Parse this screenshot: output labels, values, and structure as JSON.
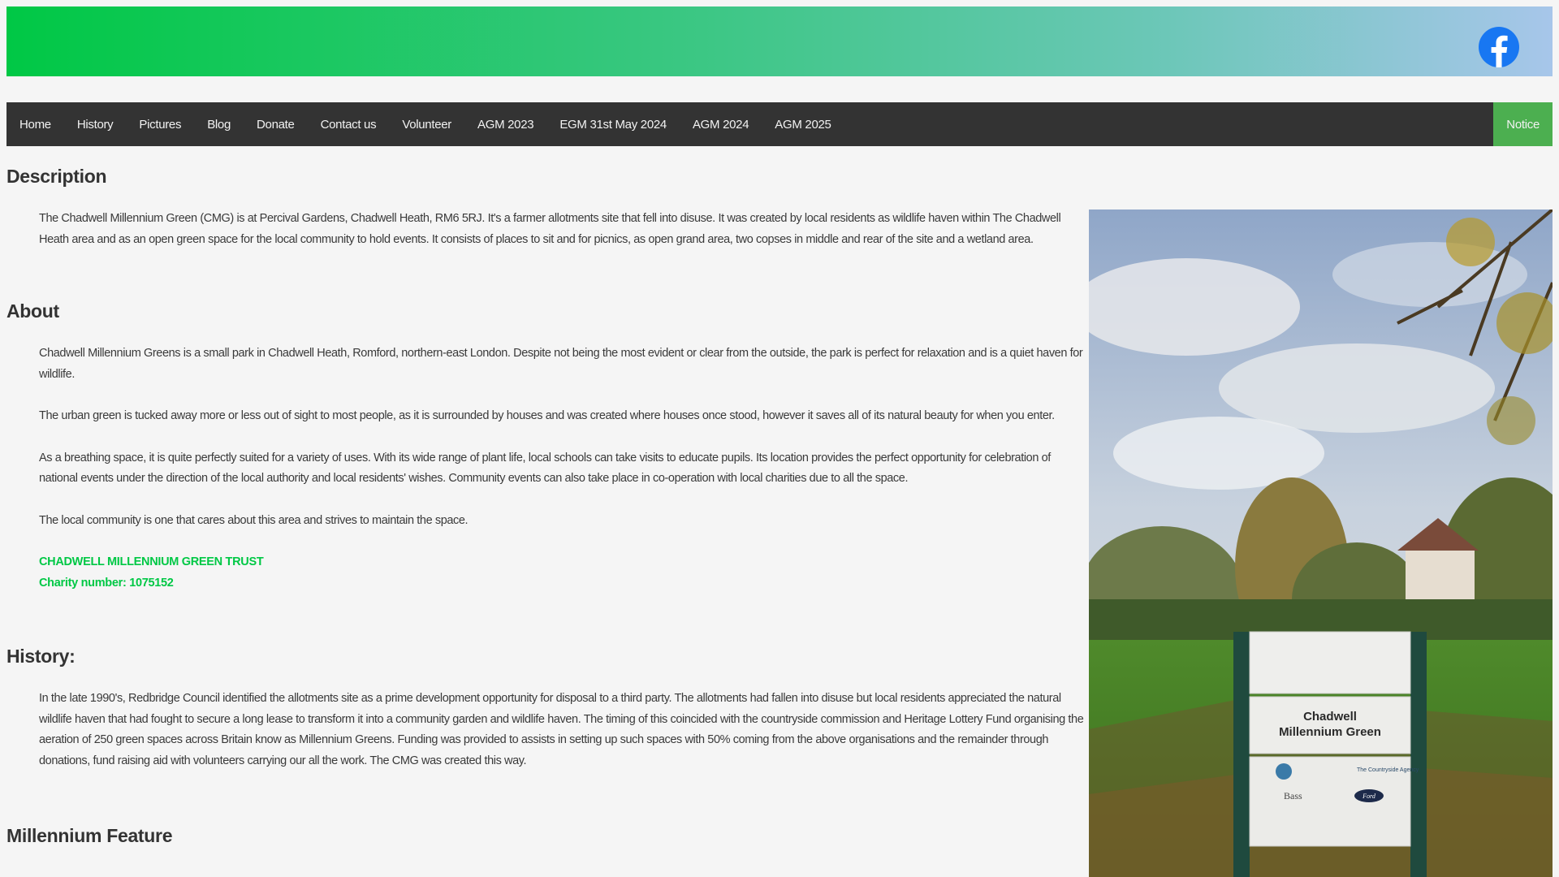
{
  "nav": {
    "items": [
      "Home",
      "History",
      "Pictures",
      "Blog",
      "Donate",
      "Contact us",
      "Volunteer",
      "AGM 2023",
      "EGM 31st May 2024",
      "AGM 2024",
      "AGM 2025"
    ],
    "notice": "Notice"
  },
  "icons": {
    "social": "facebook-icon"
  },
  "colors": {
    "accent_green": "#00c845",
    "nav_background": "#333333",
    "notice_background": "#4caf50",
    "facebook_blue": "#1877f2"
  },
  "sections": {
    "description": {
      "title": "Description",
      "text": "The Chadwell Millennium Green (CMG) is at Percival Gardens, Chadwell Heath, RM6 5RJ. It's a farmer allotments site that fell into disuse. It was created by local residents as wildlife haven within The Chadwell Heath area and as an open green space for the local community to hold events. It consists of places to sit and for picnics, as open grand area, two copses in middle and rear of the site and a wetland area."
    },
    "about": {
      "title": "About",
      "paragraphs": [
        "Chadwell Millennium Greens is a small park in Chadwell Heath, Romford, northern-east London. Despite not being the most evident or clear from the outside, the park is perfect for relaxation and is a quiet haven for wildlife.",
        "The urban green is tucked away more or less out of sight to most people, as it is surrounded by houses and was created where houses once stood, however it saves all of its natural beauty for when you enter.",
        "As a breathing space, it is quite perfectly suited for a variety of uses. With its wide range of plant life, local schools can take visits to educate pupils. Its location provides the perfect opportunity for celebration of national events under the direction of the local authority and local residents' wishes. Community events can also take place in co-operation with local charities due to all the space.",
        "The local community is one that cares about this area and strives to maintain the space."
      ],
      "trust_name": "CHADWELL MILLENNIUM GREEN TRUST",
      "charity_number": "Charity number: 1075152"
    },
    "history": {
      "title": "History:",
      "text": "In the late 1990's, Redbridge Council identified the allotments site as a prime development opportunity for disposal to a third party. The allotments had fallen into disuse but local residents appreciated the natural wildlife haven that had fought to secure a long lease to transform it into a community garden and wildlife haven. The timing of this coincided with the countryside commission and Heritage Lottery Fund organising the aeration of 250 green spaces across Britain know as Millennium Greens. Funding was provided to assists in setting up such spaces with 50% coming from the above organisations and the remainder through donations, fund raising aid with volunteers carrying our all the work. The CMG was created this way."
    },
    "feature": {
      "title": "Millennium Feature"
    }
  },
  "photo": {
    "sign_line1": "Chadwell",
    "sign_line2": "Millennium Green",
    "sign_logo_left": "Bass",
    "sign_logo_right": "Ford",
    "sign_agency": "The Countryside Agency"
  }
}
